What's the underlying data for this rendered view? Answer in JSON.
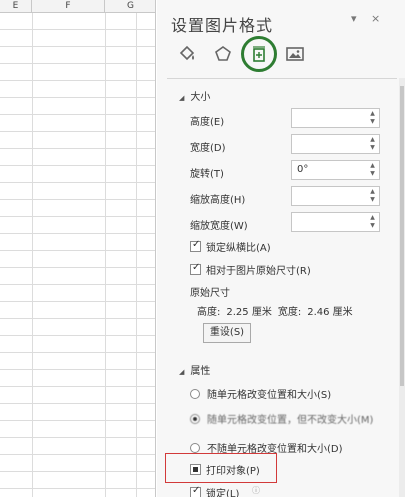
{
  "sheet": {
    "columns": [
      "E",
      "F",
      "G"
    ]
  },
  "pane": {
    "title": "设置图片格式",
    "dropdown_icon": "▾",
    "close_icon": "×",
    "tabs": [
      {
        "icon": "fill-bucket-icon",
        "active": false
      },
      {
        "icon": "pentagon-icon",
        "active": false
      },
      {
        "icon": "size-properties-icon",
        "active": true
      },
      {
        "icon": "picture-icon",
        "active": false
      }
    ],
    "size_section": {
      "title": "大小",
      "fields": [
        {
          "label": "高度(E)",
          "value": ""
        },
        {
          "label": "宽度(D)",
          "value": ""
        },
        {
          "label": "旋转(T)",
          "value": "0°"
        },
        {
          "label": "缩放高度(H)",
          "value": ""
        },
        {
          "label": "缩放宽度(W)",
          "value": ""
        }
      ],
      "lock_aspect": {
        "label": "锁定纵横比(A)",
        "checked": true
      },
      "relative_original": {
        "label": "相对于图片原始尺寸(R)",
        "checked": true
      },
      "original_size_label": "原始尺寸",
      "original_height_label": "高度:",
      "original_height_value": "2.25 厘米",
      "original_width_label": "宽度:",
      "original_width_value": "2.46 厘米",
      "reset_label": "重设(S)"
    },
    "properties_section": {
      "title": "属性",
      "options": [
        {
          "label": "随单元格改变位置和大小(S)",
          "selected": false
        },
        {
          "label": "随单元格改变位置，但不改变大小(M)",
          "selected": true
        },
        {
          "label": "不随单元格改变位置和大小(D)",
          "selected": false
        }
      ],
      "print_object": {
        "label": "打印对象(P)",
        "checked": true
      },
      "locked": {
        "label": "锁定(L)",
        "checked": true
      }
    }
  }
}
